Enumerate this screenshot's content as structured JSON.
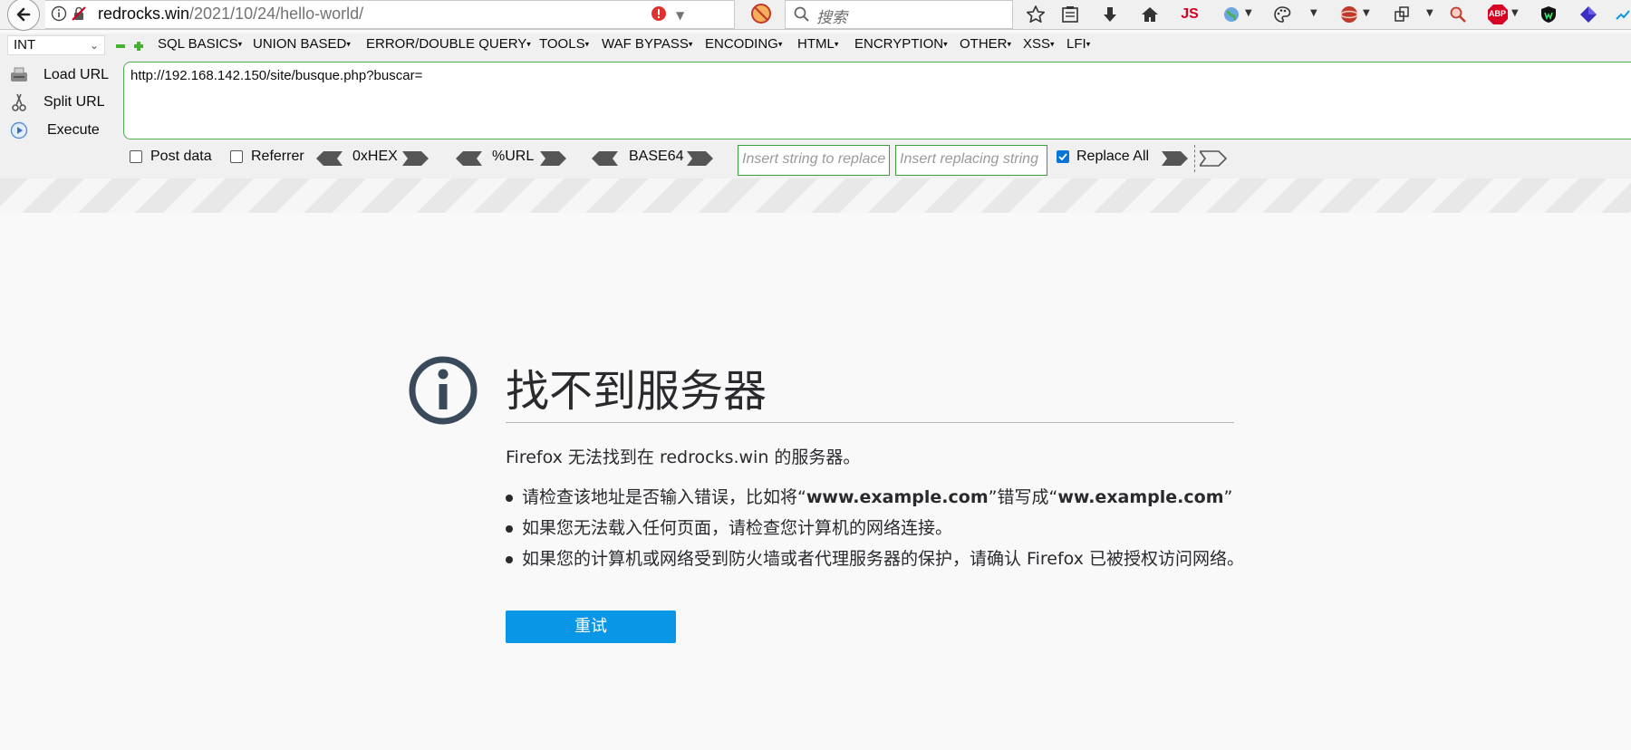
{
  "navbar": {
    "url_host": "redrocks.win",
    "url_path": "/2021/10/24/hello-world/",
    "search_placeholder": "搜索",
    "js_badge": "JS",
    "abp_badge": "ABP"
  },
  "hackbar": {
    "select_value": "INT",
    "menus": [
      "SQL BASICS",
      "UNION BASED",
      "ERROR/DOUBLE QUERY",
      "TOOLS",
      "WAF BYPASS",
      "ENCODING",
      "HTML",
      "ENCRYPTION",
      "OTHER",
      "XSS",
      "LFI"
    ],
    "load_url": "Load URL",
    "split_url": "Split URL",
    "execute": "Execute",
    "url_value": "http://192.168.142.150/site/busque.php?buscar=",
    "post_data": "Post data",
    "referrer": "Referrer",
    "hex": "0xHEX",
    "urlenc": "%URL",
    "base64": "BASE64",
    "replace_placeholder": "Insert string to replace",
    "replacing_placeholder": "Insert replacing string",
    "replace_all": "Replace All",
    "post_data_checked": false,
    "referrer_checked": false,
    "replace_all_checked": true
  },
  "error": {
    "title": "找不到服务器",
    "description": "Firefox 无法找到在 redrocks.win 的服务器。",
    "tip1_a": "请检查该地址是否输入错误，比如将“",
    "tip1_b": "www.example.com",
    "tip1_c": "”错写成“",
    "tip1_d": "ww.example.com",
    "tip1_e": "”",
    "tip2": "如果您无法载入任何页面，请检查您计算机的网络连接。",
    "tip3": "如果您的计算机或网络受到防火墙或者代理服务器的保护，请确认 Firefox 已被授权访问网络。",
    "retry": "重试"
  },
  "colors": {
    "accent_button": "#0a96e6",
    "input_border": "#4caf50",
    "title_text": "#2a2a2e"
  }
}
